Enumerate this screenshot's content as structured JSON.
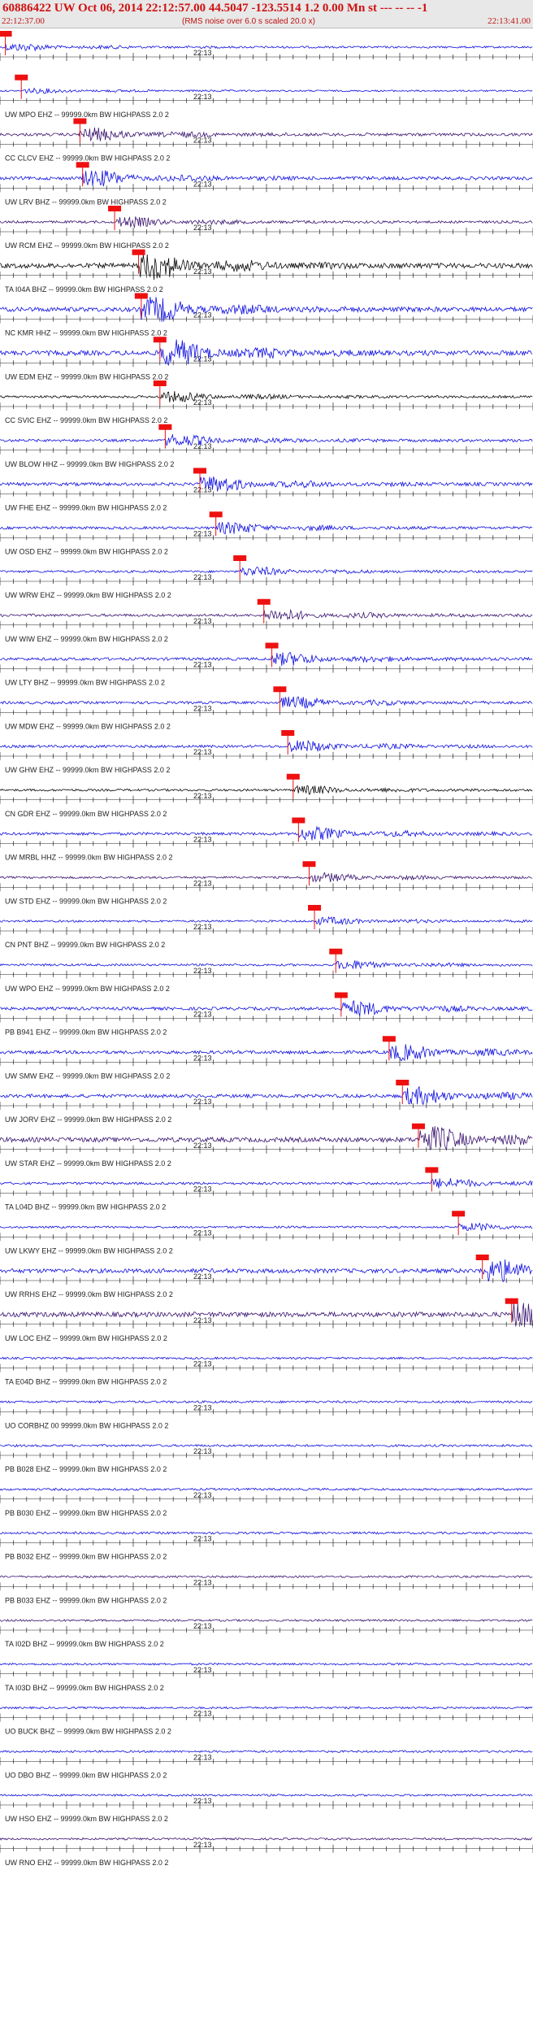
{
  "header": {
    "title": "60886422 UW Oct 06, 2014 22:12:57.00   44.5047 -123.5514  1.2 0.00 Mn st --- -- -- -1",
    "start_time": "22:12:37.00",
    "note": "(RMS noise over 6.0 s scaled 20.0 x)",
    "end_time": "22:13:41.00"
  },
  "minute_label": "22:13",
  "colors": {
    "blue": "#1010e0",
    "purple": "#3a1570",
    "black": "#0a0a0a",
    "pick": "#ee1010",
    "tick": "#222222"
  },
  "traces": [
    {
      "label": "",
      "color": "blue",
      "amp": 0.25,
      "pick": 0.01
    },
    {
      "label": "UW MPO EHZ -- 99999.0km BW  HIGHPASS  2.0  2",
      "color": "blue",
      "amp": 0.15,
      "pick": 0.04
    },
    {
      "label": "CC CLCV EHZ -- 99999.0km BW  HIGHPASS  2.0  2",
      "color": "purple",
      "amp": 0.45,
      "pick": 0.15
    },
    {
      "label": "UW LRV BHZ -- 99999.0km BW  HIGHPASS  2.0  2",
      "color": "blue",
      "amp": 0.55,
      "pick": 0.155
    },
    {
      "label": "UW RCM EHZ -- 99999.0km BW  HIGHPASS  2.0  2",
      "color": "purple",
      "amp": 0.35,
      "pick": 0.215
    },
    {
      "label": "TA I04A BHZ -- 99999.0km BW  HIGHPASS  2.0  2",
      "color": "black",
      "amp": 0.95,
      "pick": 0.26
    },
    {
      "label": "NC KMR HHZ -- 99999.0km BW  HIGHPASS  2.0  2",
      "color": "blue",
      "amp": 0.85,
      "pick": 0.265
    },
    {
      "label": "UW EDM EHZ -- 99999.0km BW  HIGHPASS  2.0  2",
      "color": "blue",
      "amp": 0.9,
      "pick": 0.3
    },
    {
      "label": "CC SVIC EHZ -- 99999.0km BW  HIGHPASS  2.0  2",
      "color": "black",
      "amp": 0.35,
      "pick": 0.3
    },
    {
      "label": "UW BLOW HHZ -- 99999.0km BW  HIGHPASS  2.0  2",
      "color": "blue",
      "amp": 0.4,
      "pick": 0.31
    },
    {
      "label": "UW FHE EHZ -- 99999.0km BW  HIGHPASS  2.0  2",
      "color": "blue",
      "amp": 0.55,
      "pick": 0.375
    },
    {
      "label": "UW OSD EHZ -- 99999.0km BW  HIGHPASS  2.0  2",
      "color": "blue",
      "amp": 0.4,
      "pick": 0.405
    },
    {
      "label": "UW WRW EHZ -- 99999.0km BW  HIGHPASS  2.0  2",
      "color": "blue",
      "amp": 0.3,
      "pick": 0.45
    },
    {
      "label": "UW WIW EHZ -- 99999.0km BW  HIGHPASS  2.0  2",
      "color": "purple",
      "amp": 0.4,
      "pick": 0.495
    },
    {
      "label": "UW LTY BHZ -- 99999.0km BW  HIGHPASS  2.0  2",
      "color": "blue",
      "amp": 0.45,
      "pick": 0.51
    },
    {
      "label": "UW MDW EHZ -- 99999.0km BW  HIGHPASS  2.0  2",
      "color": "blue",
      "amp": 0.4,
      "pick": 0.525
    },
    {
      "label": "UW GHW EHZ -- 99999.0km BW  HIGHPASS  2.0  2",
      "color": "blue",
      "amp": 0.4,
      "pick": 0.54
    },
    {
      "label": "CN GDR EHZ -- 99999.0km BW  HIGHPASS  2.0  2",
      "color": "black",
      "amp": 0.3,
      "pick": 0.55
    },
    {
      "label": "UW MRBL HHZ -- 99999.0km BW  HIGHPASS  2.0  2",
      "color": "blue",
      "amp": 0.45,
      "pick": 0.56
    },
    {
      "label": "UW STD EHZ -- 99999.0km BW  HIGHPASS  2.0  2",
      "color": "purple",
      "amp": 0.3,
      "pick": 0.58
    },
    {
      "label": "CN PNT BHZ -- 99999.0km BW  HIGHPASS  2.0  2",
      "color": "blue",
      "amp": 0.25,
      "pick": 0.59
    },
    {
      "label": "UW WPO EHZ -- 99999.0km BW  HIGHPASS  2.0  2",
      "color": "blue",
      "amp": 0.3,
      "pick": 0.63
    },
    {
      "label": "PB B941 EHZ -- 99999.0km BW  HIGHPASS  2.0  2",
      "color": "blue",
      "amp": 0.5,
      "pick": 0.64
    },
    {
      "label": "UW SMW EHZ -- 99999.0km BW  HIGHPASS  2.0  2",
      "color": "blue",
      "amp": 0.55,
      "pick": 0.73
    },
    {
      "label": "UW JORV EHZ -- 99999.0km BW  HIGHPASS  2.0  2",
      "color": "blue",
      "amp": 0.6,
      "pick": 0.755
    },
    {
      "label": "UW STAR EHZ -- 99999.0km BW  HIGHPASS  2.0  2",
      "color": "purple",
      "amp": 0.9,
      "pick": 0.785
    },
    {
      "label": "TA L04D BHZ -- 99999.0km BW  HIGHPASS  2.0  2",
      "color": "blue",
      "amp": 0.35,
      "pick": 0.81
    },
    {
      "label": "UW LKWY EHZ -- 99999.0km BW  HIGHPASS  2.0  2",
      "color": "blue",
      "amp": 0.25,
      "pick": 0.86
    },
    {
      "label": "UW RRHS EHZ -- 99999.0km BW  HIGHPASS  2.0  2",
      "color": "blue",
      "amp": 0.8,
      "pick": 0.905
    },
    {
      "label": "UW LOC EHZ -- 99999.0km BW  HIGHPASS  2.0  2",
      "color": "purple",
      "amp": 0.95,
      "pick": 0.96
    },
    {
      "label": "TA E04D BHZ -- 99999.0km BW  HIGHPASS  2.0  2",
      "color": "blue",
      "amp": 0.25,
      "pick": null
    },
    {
      "label": "UO CORBHZ 00 99999.0km BW  HIGHPASS  2.0  2",
      "color": "blue",
      "amp": 0.3,
      "pick": null
    },
    {
      "label": "PB B028 EHZ -- 99999.0km BW  HIGHPASS  2.0  2",
      "color": "blue",
      "amp": 0.3,
      "pick": null
    },
    {
      "label": "PB B030 EHZ -- 99999.0km BW  HIGHPASS  2.0  2",
      "color": "blue",
      "amp": 0.3,
      "pick": null
    },
    {
      "label": "PB B032 EHZ -- 99999.0km BW  HIGHPASS  2.0  2",
      "color": "blue",
      "amp": 0.3,
      "pick": null
    },
    {
      "label": "PB B033 EHZ -- 99999.0km BW  HIGHPASS  2.0  2",
      "color": "purple",
      "amp": 0.25,
      "pick": null
    },
    {
      "label": "TA I02D BHZ -- 99999.0km BW  HIGHPASS  2.0  2",
      "color": "purple",
      "amp": 0.25,
      "pick": null
    },
    {
      "label": "TA I03D BHZ -- 99999.0km BW  HIGHPASS  2.0  2",
      "color": "blue",
      "amp": 0.25,
      "pick": null
    },
    {
      "label": "UO BUCK BHZ -- 99999.0km BW  HIGHPASS  2.0  2",
      "color": "blue",
      "amp": 0.25,
      "pick": null
    },
    {
      "label": "UO DBO BHZ -- 99999.0km BW  HIGHPASS  2.0  2",
      "color": "blue",
      "amp": 0.25,
      "pick": null
    },
    {
      "label": "UW HSO EHZ -- 99999.0km BW  HIGHPASS  2.0  2",
      "color": "blue",
      "amp": 0.25,
      "pick": null
    },
    {
      "label": "UW RNO EHZ -- 99999.0km BW  HIGHPASS  2.0  2",
      "color": "purple",
      "amp": 0.25,
      "pick": null
    }
  ]
}
